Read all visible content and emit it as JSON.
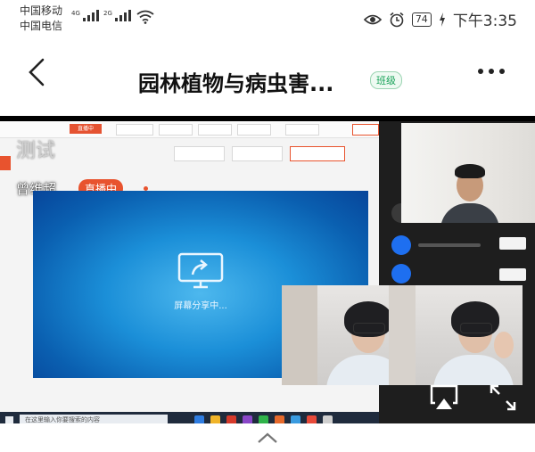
{
  "status_bar": {
    "carrier1": "中国移动",
    "carrier2": "中国电信",
    "network1": "4G",
    "network2": "2G",
    "battery": "74",
    "time": "下午3:35"
  },
  "header": {
    "title": "园林植物与病虫害...",
    "badge": "班级"
  },
  "stream": {
    "overlay_title": "测试",
    "host_name": "曾维超",
    "live_badge": "直播中",
    "shared_screen_text": "屏幕分享中...",
    "desktop": {
      "live_tab": "直播中",
      "search_placeholder": "在这里输入你要搜索的内容"
    }
  },
  "colors": {
    "live_red": "#e8532e",
    "badge_green": "#1aa35a",
    "panel_dark": "#1e1e1e"
  },
  "icons": [
    "back-icon",
    "more-icon",
    "screen-share-icon",
    "airplay-icon",
    "fullscreen-icon",
    "chevron-up-icon",
    "wifi-icon",
    "eye-icon",
    "alarm-icon",
    "charging-icon"
  ]
}
